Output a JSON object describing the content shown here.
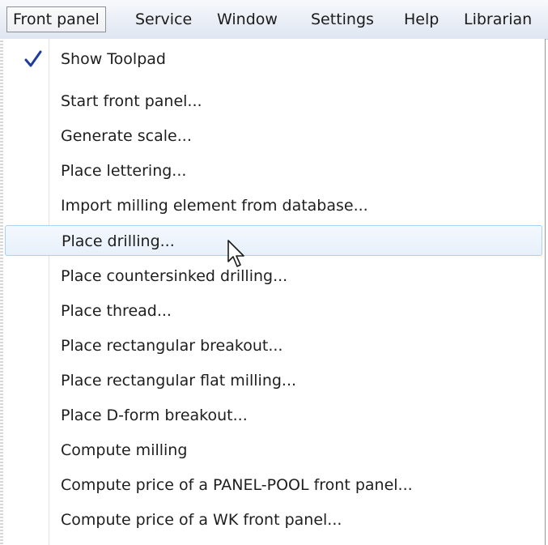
{
  "menubar": {
    "items": [
      {
        "label": "Front panel"
      },
      {
        "label": "Service"
      },
      {
        "label": "Window"
      },
      {
        "label": "Settings"
      },
      {
        "label": "Help"
      },
      {
        "label": "Librarian"
      }
    ],
    "active_index": 0
  },
  "dropdown": {
    "items": [
      {
        "label": "Show Toolpad",
        "checked": true
      },
      {
        "label": "Start front panel..."
      },
      {
        "label": "Generate scale..."
      },
      {
        "label": "Place lettering..."
      },
      {
        "label": "Import milling element from database..."
      },
      {
        "label": "Place drilling...",
        "hovered": true
      },
      {
        "label": "Place countersinked drilling..."
      },
      {
        "label": "Place thread..."
      },
      {
        "label": "Place rectangular breakout..."
      },
      {
        "label": "Place rectangular flat milling..."
      },
      {
        "label": "Place D-form breakout..."
      },
      {
        "label": "Compute milling"
      },
      {
        "label": "Compute price of a PANEL-POOL front panel..."
      },
      {
        "label": "Compute price of a WK front panel..."
      }
    ]
  },
  "icons": {
    "check": "check-icon",
    "cursor": "mouse-pointer-icon"
  },
  "colors": {
    "hover_border": "#a8d1f2",
    "hover_fill": "#e7f0fa",
    "check": "#1f3c9e"
  }
}
